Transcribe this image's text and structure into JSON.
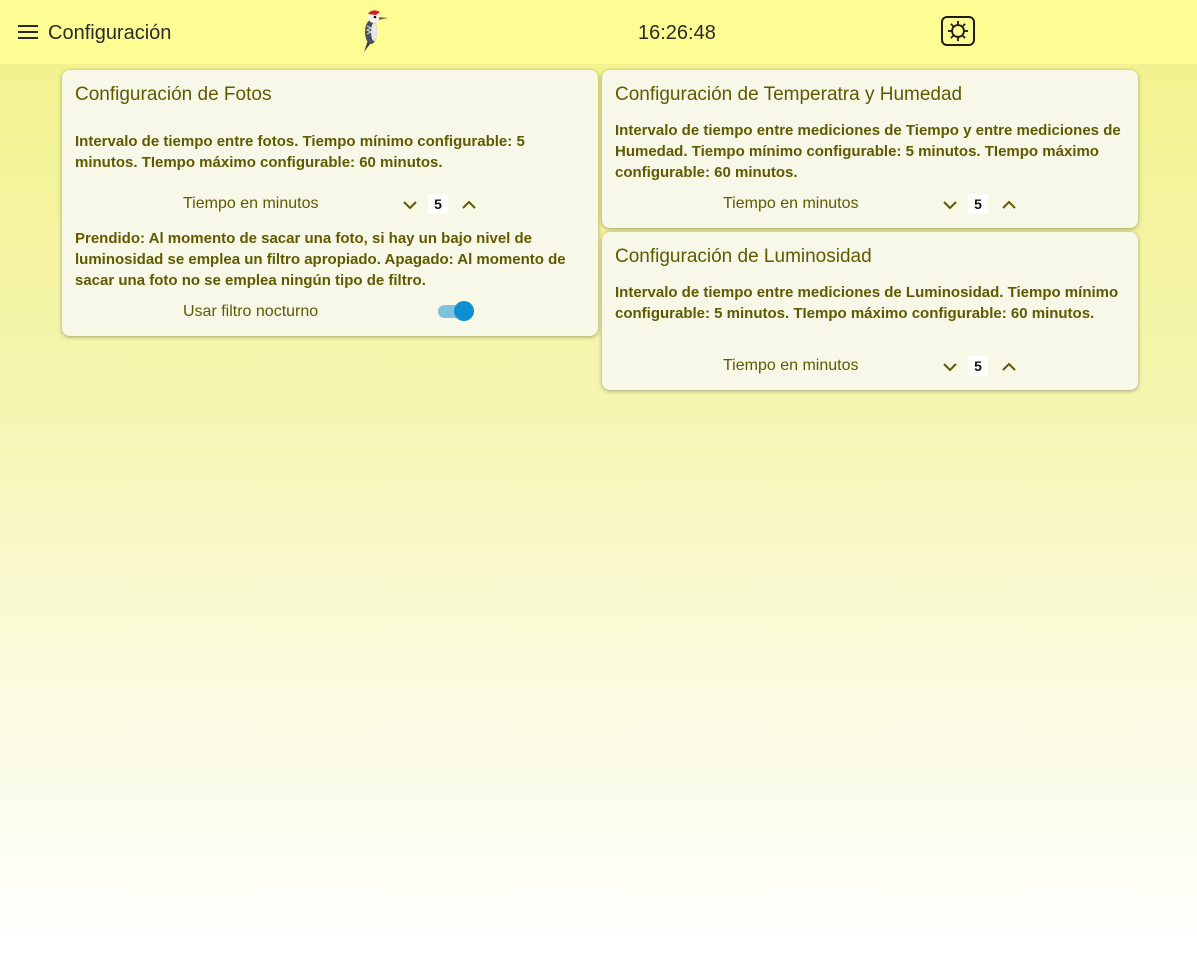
{
  "header": {
    "title": "Configuración",
    "clock": "16:26:48"
  },
  "cards": {
    "fotos": {
      "title": "Configuración de Fotos",
      "description": "Intervalo de tiempo entre fotos. Tiempo mínimo configurable: 5 minutos. TIempo máximo configurable: 60 minutos.",
      "stepper_label": "Tiempo en minutos",
      "stepper_value": "5",
      "filter_description": "Prendido: Al momento de sacar una foto, si hay un bajo nivel de luminosidad se emplea un filtro apropiado. Apagado: Al momento de sacar una foto no se emplea ningún tipo de filtro.",
      "toggle_label": "Usar filtro nocturno",
      "toggle_on": true
    },
    "temperatura": {
      "title": "Configuración de Temperatra y Humedad",
      "description": "Intervalo de tiempo entre mediciones de Tiempo y entre mediciones de Humedad. Tiempo mínimo configurable: 5 minutos. TIempo máximo configurable: 60 minutos.",
      "stepper_label": "Tiempo en minutos",
      "stepper_value": "5"
    },
    "luminosidad": {
      "title": "Configuración de Luminosidad",
      "description": "Intervalo de tiempo entre mediciones de Luminosidad. Tiempo mínimo configurable: 5 minutos. TIempo máximo configurable: 60 minutos.",
      "stepper_label": "Tiempo en minutos",
      "stepper_value": "5"
    }
  },
  "icons": {
    "menu": "menu-icon",
    "logo": "woodpecker-logo",
    "settings": "gear-icon",
    "decrement": "chevron-down-icon",
    "increment": "chevron-up-icon"
  },
  "colors": {
    "topbar": "#fdfd94",
    "card_text": "#5f5a00",
    "toggle_on": "#0d8fd0"
  }
}
